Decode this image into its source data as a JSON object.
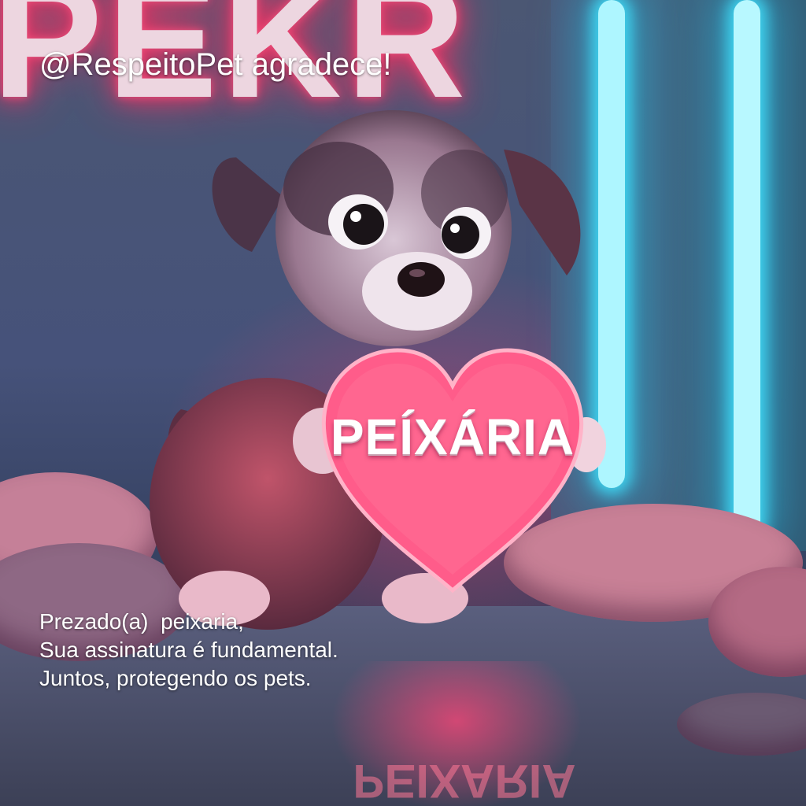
{
  "header": {
    "handle_text": "@RespeitoPet agradece!"
  },
  "background": {
    "neon_sign_text": "PEKR",
    "neon_pink": "#ff2f62",
    "neon_cyan": "#3fd4f0"
  },
  "heart_sign": {
    "text": "PEÍXÁRIA",
    "reflection_text": "PEIXARIA",
    "color": "#ff5c8a"
  },
  "message": {
    "line1": "Prezado(a)  peixaria,",
    "line2": "Sua assinatura é fundamental.",
    "line3": "Juntos, protegendo os pets."
  }
}
